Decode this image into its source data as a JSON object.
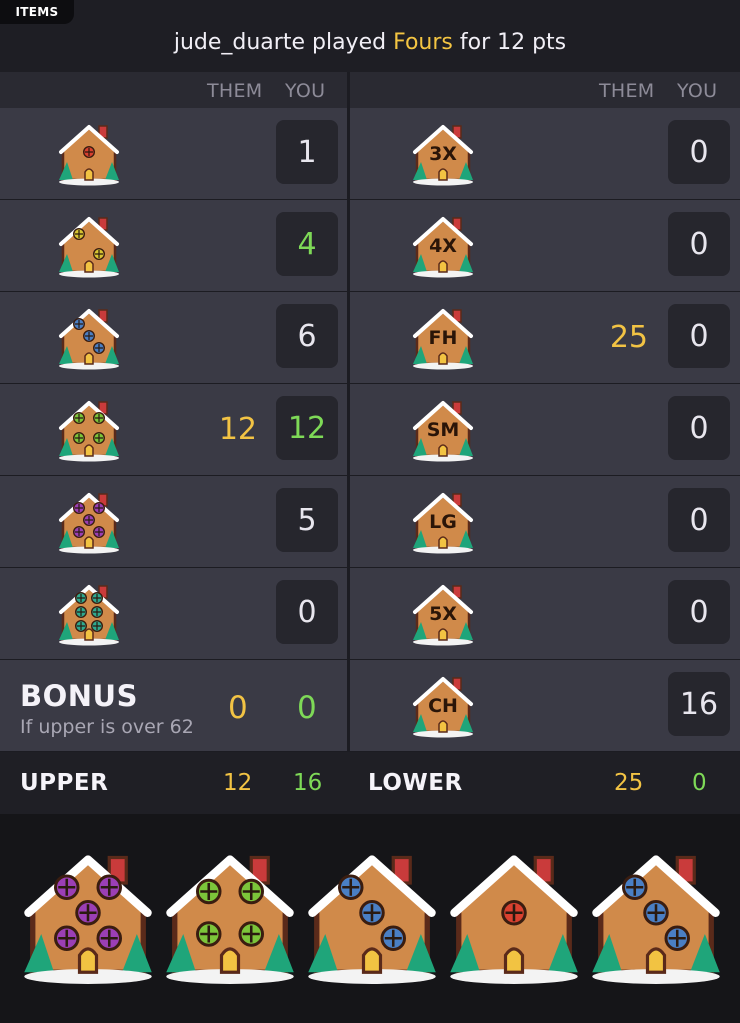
{
  "top": {
    "items_tab": "ITEMS"
  },
  "status": {
    "player": "jude_duarte",
    "played": "played",
    "category": "Fours",
    "suffix": "for 12 pts"
  },
  "columns": {
    "them": "THEM",
    "you": "YOU"
  },
  "upper": [
    {
      "face": 1,
      "them": "",
      "you": "1",
      "you_color": "white"
    },
    {
      "face": 2,
      "them": "",
      "you": "4",
      "you_color": "green"
    },
    {
      "face": 3,
      "them": "",
      "you": "6",
      "you_color": "white"
    },
    {
      "face": 4,
      "them": "12",
      "you": "12",
      "you_color": "green"
    },
    {
      "face": 5,
      "them": "",
      "you": "5",
      "you_color": "white"
    },
    {
      "face": 6,
      "them": "",
      "you": "0",
      "you_color": "white"
    }
  ],
  "lower": [
    {
      "label": "3X",
      "them": "",
      "you": "0"
    },
    {
      "label": "4X",
      "them": "",
      "you": "0"
    },
    {
      "label": "FH",
      "them": "25",
      "you": "0"
    },
    {
      "label": "SM",
      "them": "",
      "you": "0"
    },
    {
      "label": "LG",
      "them": "",
      "you": "0"
    },
    {
      "label": "5X",
      "them": "",
      "you": "0"
    },
    {
      "label": "CH",
      "them": "",
      "you": "16"
    }
  ],
  "bonus": {
    "title": "BONUS",
    "subtitle": "If upper is over 62",
    "them": "0",
    "you": "0"
  },
  "totals": {
    "upper_label": "UPPER",
    "upper_them": "12",
    "upper_you": "16",
    "lower_label": "LOWER",
    "lower_them": "25",
    "lower_you": "0"
  },
  "dice": [
    5,
    4,
    3,
    1,
    3
  ],
  "colors": {
    "accent_yellow": "#f2c344",
    "accent_green": "#7ed957",
    "cell_bg": "#3a3a45",
    "box_bg": "#26262d",
    "pip_1": "#d9412f",
    "pip_2": "#d8c532",
    "pip_3": "#4a7fc4",
    "pip_4": "#7cc53a",
    "pip_5": "#9b3fb5",
    "pip_6": "#2fa98f"
  }
}
